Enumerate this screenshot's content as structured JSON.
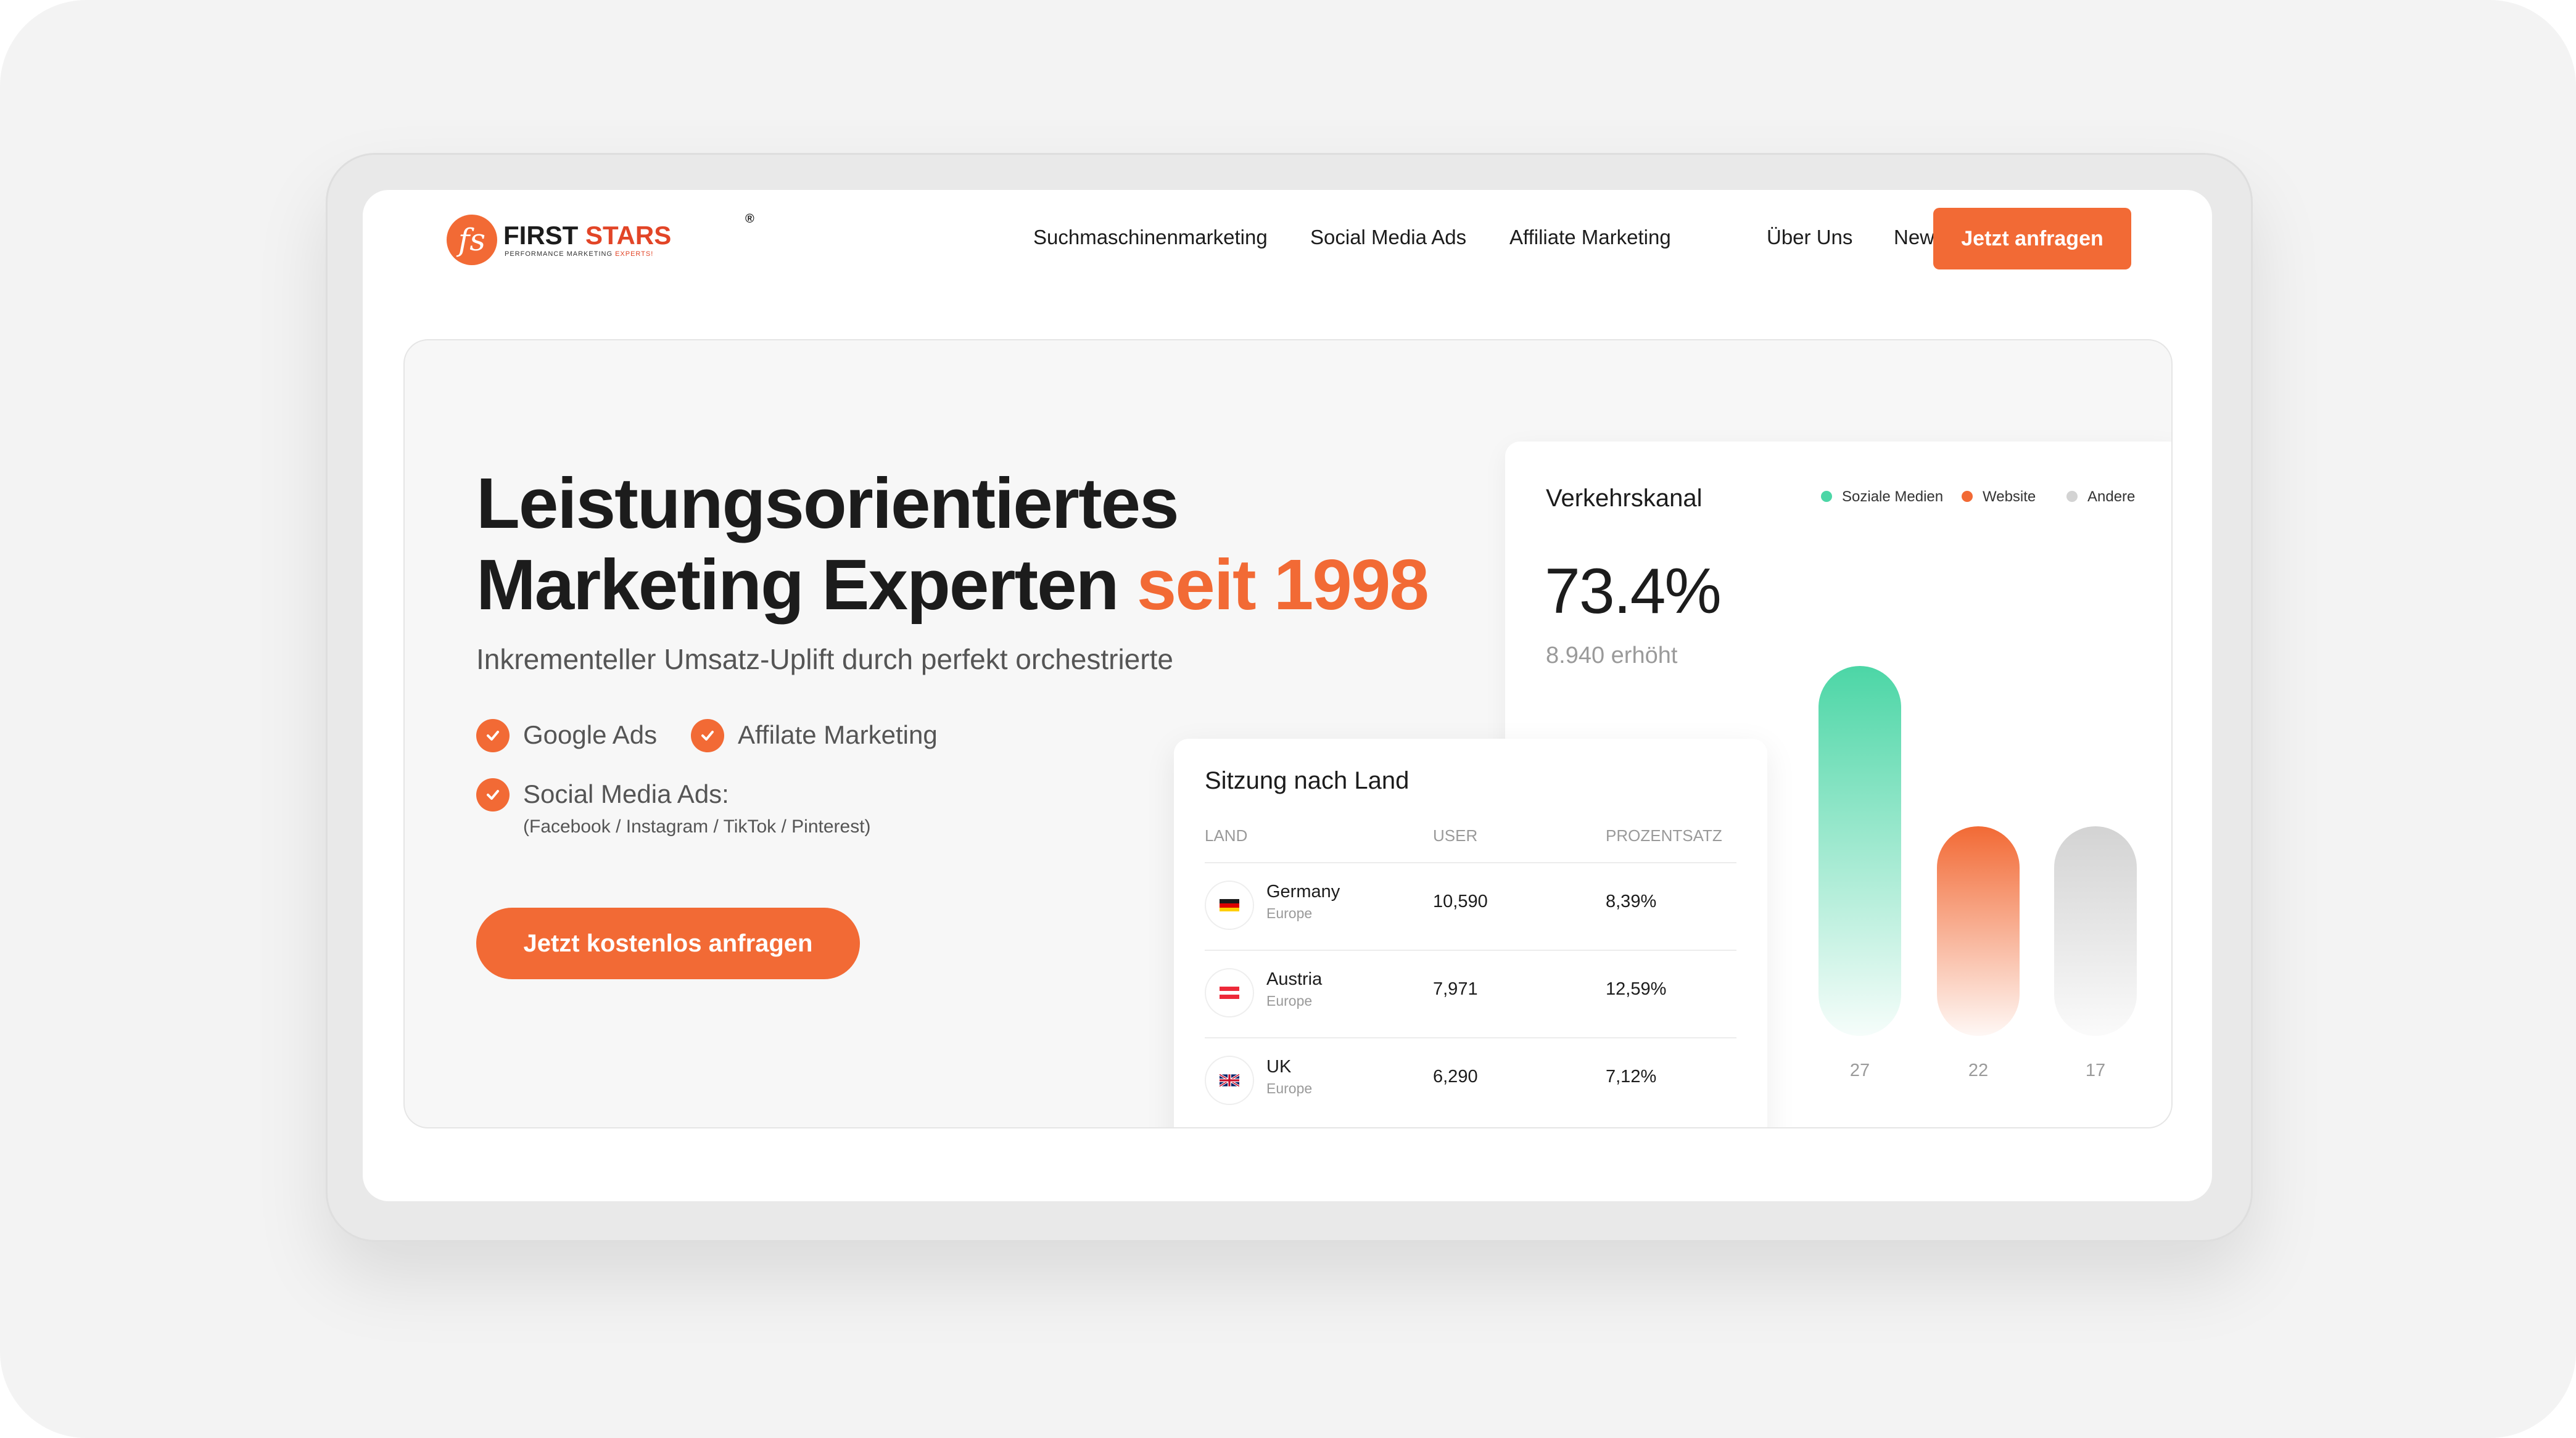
{
  "brand": {
    "name_first": "FIRST",
    "name_second": "STARS",
    "registered": "®",
    "tagline_start": "PERFORMANCE MARKETING ",
    "tagline_accent": "EXPERTS!",
    "mark": "fs"
  },
  "nav": {
    "items": [
      "Suchmaschinenmarketing",
      "Social Media Ads",
      "Affiliate Marketing",
      "Über Uns",
      "News"
    ],
    "cta_label": "Jetzt anfragen"
  },
  "hero": {
    "title_line1": "Leistungsorientiertes",
    "title_line2": "Marketing Experten",
    "title_accent": "seit 1998",
    "subline": "Inkrementeller Umsatz-Uplift durch perfekt orchestrierte",
    "features": [
      "Google Ads",
      "Affilate Marketing",
      "Social Media Ads:"
    ],
    "social_detail": "(Facebook / Instagram / TikTok / Pinterest)",
    "cta_label": "Jetzt kostenlos anfragen"
  },
  "traffic": {
    "title": "Verkehrskanal",
    "percent": "73.4%",
    "sub": "8.940 erhöht",
    "chart_data": {
      "type": "bar",
      "categories": [
        "Soziale Medien",
        "Website",
        "Andere"
      ],
      "values": [
        27,
        22,
        17
      ],
      "value_labels": [
        "27",
        "22",
        "17"
      ],
      "legend": [
        "Soziale Medien",
        "Website",
        "Andere"
      ],
      "colors": [
        "#4cd6a6",
        "#f26a35",
        "#d3d3d3"
      ],
      "legend_placement": "top-right"
    }
  },
  "sessions": {
    "title": "Sitzung nach Land",
    "headers": [
      "LAND",
      "USER",
      "PROZENTSATZ"
    ],
    "rows": [
      {
        "country": "Germany",
        "region": "Europe",
        "users": "10,590",
        "percent": "8,39%"
      },
      {
        "country": "Austria",
        "region": "Europe",
        "users": "7,971",
        "percent": "12,59%"
      },
      {
        "country": "UK",
        "region": "Europe",
        "users": "6,290",
        "percent": "7,12%"
      }
    ]
  },
  "colors": {
    "accent": "#f26a35",
    "green": "#4cd6a6",
    "grey_bar": "#d3d3d3"
  }
}
